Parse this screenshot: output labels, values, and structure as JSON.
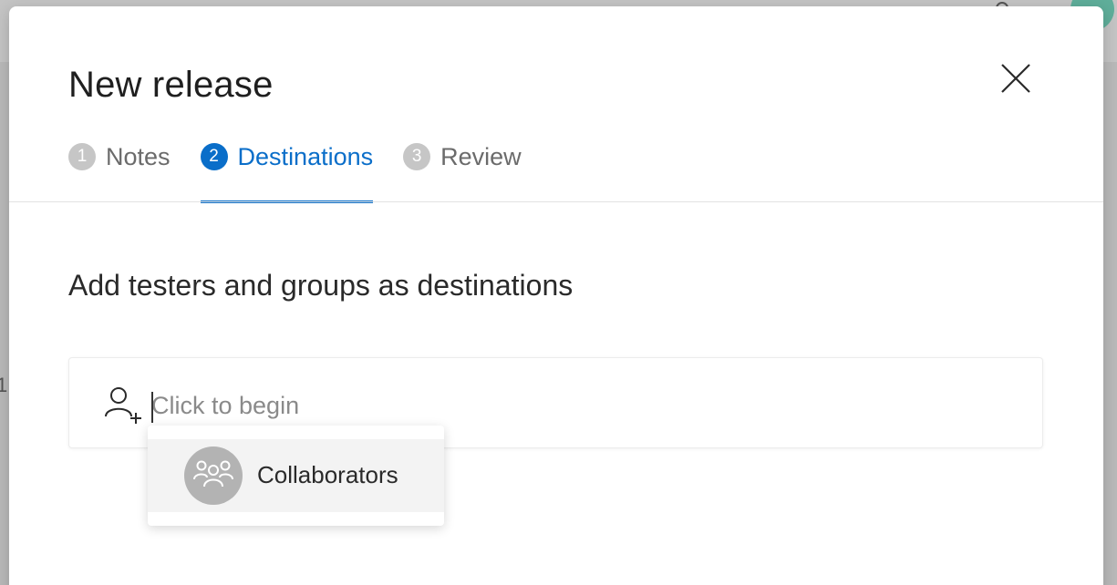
{
  "dialog": {
    "title": "New release",
    "close_icon": "close-icon"
  },
  "tabs": [
    {
      "number": "1",
      "label": "Notes",
      "active": false
    },
    {
      "number": "2",
      "label": "Destinations",
      "active": true
    },
    {
      "number": "3",
      "label": "Review",
      "active": false
    }
  ],
  "section": {
    "heading": "Add testers and groups as destinations"
  },
  "picker": {
    "icon": "add-person-icon",
    "placeholder": "Click to begin",
    "value": ""
  },
  "dropdown": {
    "options": [
      {
        "label": "Collaborators",
        "icon": "group-icon"
      }
    ]
  },
  "colors": {
    "accent": "#0a6ec9",
    "inactive_step": "#c6c6c6",
    "option_hover": "#f3f3f3"
  }
}
